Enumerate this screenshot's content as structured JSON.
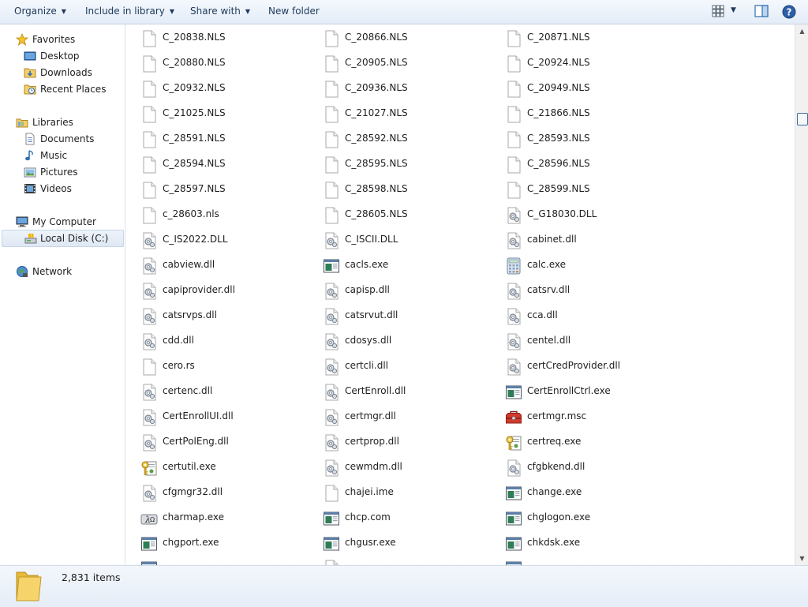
{
  "toolbar": {
    "organize": "Organize",
    "include_in_library": "Include in library",
    "share_with": "Share with",
    "new_folder": "New folder"
  },
  "sidebar": {
    "favorites": "Favorites",
    "desktop": "Desktop",
    "downloads": "Downloads",
    "recent_places": "Recent Places",
    "libraries": "Libraries",
    "documents": "Documents",
    "music": "Music",
    "pictures": "Pictures",
    "videos": "Videos",
    "my_computer": "My Computer",
    "local_disk": "Local Disk (C:)",
    "network": "Network"
  },
  "files": [
    {
      "name": "C_20838.NLS",
      "icon": "blank-file-icon"
    },
    {
      "name": "C_20866.NLS",
      "icon": "blank-file-icon"
    },
    {
      "name": "C_20871.NLS",
      "icon": "blank-file-icon"
    },
    {
      "name": "C_20880.NLS",
      "icon": "blank-file-icon"
    },
    {
      "name": "C_20905.NLS",
      "icon": "blank-file-icon"
    },
    {
      "name": "C_20924.NLS",
      "icon": "blank-file-icon"
    },
    {
      "name": "C_20932.NLS",
      "icon": "blank-file-icon"
    },
    {
      "name": "C_20936.NLS",
      "icon": "blank-file-icon"
    },
    {
      "name": "C_20949.NLS",
      "icon": "blank-file-icon"
    },
    {
      "name": "C_21025.NLS",
      "icon": "blank-file-icon"
    },
    {
      "name": "C_21027.NLS",
      "icon": "blank-file-icon"
    },
    {
      "name": "C_21866.NLS",
      "icon": "blank-file-icon"
    },
    {
      "name": "C_28591.NLS",
      "icon": "blank-file-icon"
    },
    {
      "name": "C_28592.NLS",
      "icon": "blank-file-icon"
    },
    {
      "name": "C_28593.NLS",
      "icon": "blank-file-icon"
    },
    {
      "name": "C_28594.NLS",
      "icon": "blank-file-icon"
    },
    {
      "name": "C_28595.NLS",
      "icon": "blank-file-icon"
    },
    {
      "name": "C_28596.NLS",
      "icon": "blank-file-icon"
    },
    {
      "name": "C_28597.NLS",
      "icon": "blank-file-icon"
    },
    {
      "name": "C_28598.NLS",
      "icon": "blank-file-icon"
    },
    {
      "name": "C_28599.NLS",
      "icon": "blank-file-icon"
    },
    {
      "name": "c_28603.nls",
      "icon": "blank-file-icon"
    },
    {
      "name": "C_28605.NLS",
      "icon": "blank-file-icon"
    },
    {
      "name": "C_G18030.DLL",
      "icon": "dll-file-icon"
    },
    {
      "name": "C_IS2022.DLL",
      "icon": "dll-file-icon"
    },
    {
      "name": "C_ISCII.DLL",
      "icon": "dll-file-icon"
    },
    {
      "name": "cabinet.dll",
      "icon": "dll-file-icon"
    },
    {
      "name": "cabview.dll",
      "icon": "dll-file-icon"
    },
    {
      "name": "cacls.exe",
      "icon": "console-exe-icon"
    },
    {
      "name": "calc.exe",
      "icon": "calculator-icon"
    },
    {
      "name": "capiprovider.dll",
      "icon": "dll-file-icon"
    },
    {
      "name": "capisp.dll",
      "icon": "dll-file-icon"
    },
    {
      "name": "catsrv.dll",
      "icon": "dll-file-icon"
    },
    {
      "name": "catsrvps.dll",
      "icon": "dll-file-icon"
    },
    {
      "name": "catsrvut.dll",
      "icon": "dll-file-icon"
    },
    {
      "name": "cca.dll",
      "icon": "dll-file-icon"
    },
    {
      "name": "cdd.dll",
      "icon": "dll-file-icon"
    },
    {
      "name": "cdosys.dll",
      "icon": "dll-file-icon"
    },
    {
      "name": "centel.dll",
      "icon": "dll-file-icon"
    },
    {
      "name": "cero.rs",
      "icon": "blank-file-icon"
    },
    {
      "name": "certcli.dll",
      "icon": "dll-file-icon"
    },
    {
      "name": "certCredProvider.dll",
      "icon": "dll-file-icon"
    },
    {
      "name": "certenc.dll",
      "icon": "dll-file-icon"
    },
    {
      "name": "CertEnroll.dll",
      "icon": "dll-file-icon"
    },
    {
      "name": "CertEnrollCtrl.exe",
      "icon": "console-exe-icon"
    },
    {
      "name": "CertEnrollUI.dll",
      "icon": "dll-file-icon"
    },
    {
      "name": "certmgr.dll",
      "icon": "dll-file-icon"
    },
    {
      "name": "certmgr.msc",
      "icon": "toolbox-icon"
    },
    {
      "name": "CertPolEng.dll",
      "icon": "dll-file-icon"
    },
    {
      "name": "certprop.dll",
      "icon": "dll-file-icon"
    },
    {
      "name": "certreq.exe",
      "icon": "certificate-keys-icon"
    },
    {
      "name": "certutil.exe",
      "icon": "certificate-keys-icon"
    },
    {
      "name": "cewmdm.dll",
      "icon": "dll-file-icon"
    },
    {
      "name": "cfgbkend.dll",
      "icon": "dll-file-icon"
    },
    {
      "name": "cfgmgr32.dll",
      "icon": "dll-file-icon"
    },
    {
      "name": "chajei.ime",
      "icon": "blank-file-icon"
    },
    {
      "name": "change.exe",
      "icon": "console-exe-icon"
    },
    {
      "name": "charmap.exe",
      "icon": "charmap-icon"
    },
    {
      "name": "chcp.com",
      "icon": "console-exe-icon"
    },
    {
      "name": "chglogon.exe",
      "icon": "console-exe-icon"
    },
    {
      "name": "chgport.exe",
      "icon": "console-exe-icon"
    },
    {
      "name": "chgusr.exe",
      "icon": "console-exe-icon"
    },
    {
      "name": "chkdsk.exe",
      "icon": "console-exe-icon"
    }
  ],
  "status": {
    "item_count": "2,831 items"
  }
}
